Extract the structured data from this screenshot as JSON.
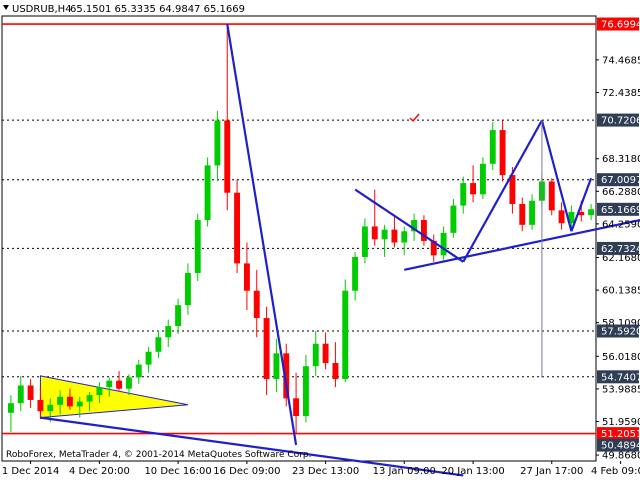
{
  "header": {
    "symbol": "USDRUB,H4",
    "ohlc": "65.1501 65.3335 64.9847 65.1669"
  },
  "footer": {
    "copyright": "RoboForex, MetaTrader 4, © 2001-2014 MetaQuotes Software Corp."
  },
  "colors": {
    "bull": "#00cc00",
    "bear": "#ff0000",
    "level_line": "#ff0000",
    "trend_blue": "#1f1fcc",
    "triangle_fill": "#ffff00",
    "price_badge": "#2f3d55",
    "red_badge": "#ff0000"
  },
  "chart_data": {
    "type": "candlestick",
    "title": "USDRUB,H4",
    "ylim": [
      49.5,
      77.2
    ],
    "x_tick_labels": [
      "1 Dec 2014",
      "4 Dec 20:00",
      "10 Dec 16:00",
      "16 Dec 09:00",
      "23 Dec 13:00",
      "13 Jan 09:00",
      "20 Jan 13:00",
      "27 Jan 17:00",
      "4 Feb 09:00"
    ],
    "y_tick_labels": [
      "74.4685",
      "72.4385",
      "68.3180",
      "66.2880",
      "64.2590",
      "62.1680",
      "60.1385",
      "58.1090",
      "56.0180",
      "53.9885",
      "51.9590",
      "49.8680"
    ],
    "price_labels": [
      {
        "label": "76.6994",
        "value": 76.6994,
        "style": "red"
      },
      {
        "label": "70.7206",
        "value": 70.7206,
        "style": "dark"
      },
      {
        "label": "67.0097",
        "value": 67.0097,
        "style": "dark"
      },
      {
        "label": "65.1669",
        "value": 65.1669,
        "style": "dark"
      },
      {
        "label": "62.7324",
        "value": 62.7324,
        "style": "dark"
      },
      {
        "label": "57.5920",
        "value": 57.592,
        "style": "dark"
      },
      {
        "label": "54.7407",
        "value": 54.7407,
        "style": "dark"
      },
      {
        "label": "51.2051",
        "value": 51.2051,
        "style": "red"
      },
      {
        "label": "50.4894",
        "value": 50.4894,
        "style": "dark"
      }
    ],
    "horizontal_levels": [
      {
        "value": 76.6994,
        "style": "solid-red"
      },
      {
        "value": 70.7206,
        "style": "dotted"
      },
      {
        "value": 67.0097,
        "style": "dotted"
      },
      {
        "value": 62.7324,
        "style": "dotted"
      },
      {
        "value": 57.592,
        "style": "dotted"
      },
      {
        "value": 54.7407,
        "style": "dotted"
      },
      {
        "value": 51.2051,
        "style": "solid-red"
      }
    ],
    "candles": [
      {
        "o": 52.5,
        "h": 53.6,
        "l": 51.3,
        "c": 53.1
      },
      {
        "o": 53.1,
        "h": 54.8,
        "l": 52.6,
        "c": 54.2
      },
      {
        "o": 54.2,
        "h": 54.6,
        "l": 52.8,
        "c": 53.3
      },
      {
        "o": 53.3,
        "h": 54.1,
        "l": 52.1,
        "c": 52.6
      },
      {
        "o": 52.6,
        "h": 53.4,
        "l": 51.9,
        "c": 53.0
      },
      {
        "o": 53.0,
        "h": 53.9,
        "l": 52.4,
        "c": 53.5
      },
      {
        "o": 53.5,
        "h": 54.0,
        "l": 52.7,
        "c": 52.9
      },
      {
        "o": 52.9,
        "h": 53.5,
        "l": 52.2,
        "c": 53.2
      },
      {
        "o": 53.2,
        "h": 53.8,
        "l": 52.6,
        "c": 53.6
      },
      {
        "o": 53.6,
        "h": 54.4,
        "l": 53.1,
        "c": 54.1
      },
      {
        "o": 54.1,
        "h": 54.7,
        "l": 53.5,
        "c": 54.5
      },
      {
        "o": 54.5,
        "h": 55.1,
        "l": 53.9,
        "c": 54.0
      },
      {
        "o": 54.0,
        "h": 54.9,
        "l": 53.6,
        "c": 54.7
      },
      {
        "o": 54.7,
        "h": 55.8,
        "l": 54.3,
        "c": 55.5
      },
      {
        "o": 55.5,
        "h": 56.6,
        "l": 55.0,
        "c": 56.3
      },
      {
        "o": 56.3,
        "h": 57.6,
        "l": 55.9,
        "c": 57.2
      },
      {
        "o": 57.2,
        "h": 58.3,
        "l": 56.6,
        "c": 57.9
      },
      {
        "o": 57.9,
        "h": 59.6,
        "l": 57.4,
        "c": 59.2
      },
      {
        "o": 59.2,
        "h": 61.8,
        "l": 58.6,
        "c": 61.2
      },
      {
        "o": 61.2,
        "h": 64.9,
        "l": 60.7,
        "c": 64.5
      },
      {
        "o": 64.5,
        "h": 68.4,
        "l": 64.1,
        "c": 67.9
      },
      {
        "o": 67.9,
        "h": 71.3,
        "l": 66.9,
        "c": 70.7
      },
      {
        "o": 70.7,
        "h": 76.7,
        "l": 65.1,
        "c": 66.2
      },
      {
        "o": 66.2,
        "h": 67.0,
        "l": 61.2,
        "c": 61.8
      },
      {
        "o": 61.8,
        "h": 63.1,
        "l": 58.9,
        "c": 60.1
      },
      {
        "o": 60.1,
        "h": 61.4,
        "l": 57.2,
        "c": 58.4
      },
      {
        "o": 58.4,
        "h": 59.1,
        "l": 53.6,
        "c": 54.6
      },
      {
        "o": 54.6,
        "h": 57.1,
        "l": 53.8,
        "c": 56.2
      },
      {
        "o": 56.2,
        "h": 56.8,
        "l": 52.9,
        "c": 53.4
      },
      {
        "o": 53.4,
        "h": 55.0,
        "l": 51.2,
        "c": 52.3
      },
      {
        "o": 52.3,
        "h": 56.1,
        "l": 51.9,
        "c": 55.4
      },
      {
        "o": 55.4,
        "h": 57.6,
        "l": 54.8,
        "c": 56.8
      },
      {
        "o": 56.8,
        "h": 57.5,
        "l": 55.2,
        "c": 55.6
      },
      {
        "o": 55.6,
        "h": 56.9,
        "l": 54.1,
        "c": 54.6
      },
      {
        "o": 54.6,
        "h": 60.8,
        "l": 54.4,
        "c": 60.1
      },
      {
        "o": 60.1,
        "h": 62.5,
        "l": 59.5,
        "c": 62.2
      },
      {
        "o": 62.2,
        "h": 64.6,
        "l": 61.8,
        "c": 64.1
      },
      {
        "o": 64.1,
        "h": 66.4,
        "l": 62.9,
        "c": 63.3
      },
      {
        "o": 63.3,
        "h": 64.2,
        "l": 62.2,
        "c": 63.9
      },
      {
        "o": 63.9,
        "h": 64.8,
        "l": 62.8,
        "c": 63.1
      },
      {
        "o": 63.1,
        "h": 64.1,
        "l": 62.3,
        "c": 63.8
      },
      {
        "o": 63.8,
        "h": 64.9,
        "l": 63.2,
        "c": 64.5
      },
      {
        "o": 64.5,
        "h": 64.8,
        "l": 62.9,
        "c": 63.2
      },
      {
        "o": 63.2,
        "h": 63.6,
        "l": 61.9,
        "c": 62.3
      },
      {
        "o": 62.3,
        "h": 64.1,
        "l": 62.0,
        "c": 63.7
      },
      {
        "o": 63.7,
        "h": 65.8,
        "l": 63.4,
        "c": 65.4
      },
      {
        "o": 65.4,
        "h": 67.2,
        "l": 64.9,
        "c": 66.8
      },
      {
        "o": 66.8,
        "h": 67.9,
        "l": 65.6,
        "c": 66.1
      },
      {
        "o": 66.1,
        "h": 68.4,
        "l": 65.8,
        "c": 68.0
      },
      {
        "o": 68.0,
        "h": 70.6,
        "l": 67.6,
        "c": 70.1
      },
      {
        "o": 70.1,
        "h": 70.7,
        "l": 66.9,
        "c": 67.3
      },
      {
        "o": 67.3,
        "h": 67.8,
        "l": 64.9,
        "c": 65.5
      },
      {
        "o": 65.5,
        "h": 65.9,
        "l": 63.8,
        "c": 64.2
      },
      {
        "o": 64.2,
        "h": 66.1,
        "l": 63.9,
        "c": 65.7
      },
      {
        "o": 65.7,
        "h": 67.4,
        "l": 65.2,
        "c": 66.9
      },
      {
        "o": 66.9,
        "h": 67.1,
        "l": 64.8,
        "c": 65.1
      },
      {
        "o": 65.1,
        "h": 65.6,
        "l": 63.9,
        "c": 64.3
      },
      {
        "o": 64.3,
        "h": 65.4,
        "l": 64.0,
        "c": 65.0
      },
      {
        "o": 65.0,
        "h": 65.7,
        "l": 64.4,
        "c": 64.8
      },
      {
        "o": 64.8,
        "h": 65.5,
        "l": 64.5,
        "c": 65.17
      }
    ],
    "drawn_lines": [
      {
        "name": "blue-drop",
        "style": "blue-thick",
        "points": [
          [
            22,
            76.7
          ],
          [
            29,
            50.5
          ]
        ]
      },
      {
        "name": "blue-base",
        "style": "blue-thick",
        "points": [
          [
            3,
            52.2
          ],
          [
            46,
            48.6
          ]
        ]
      },
      {
        "name": "blue-wave-a",
        "style": "blue-thick",
        "points": [
          [
            35,
            66.4
          ],
          [
            46,
            61.9
          ]
        ]
      },
      {
        "name": "blue-wave-b",
        "style": "blue-thick",
        "points": [
          [
            46,
            61.9
          ],
          [
            54,
            70.7
          ]
        ]
      },
      {
        "name": "blue-wave-c",
        "style": "blue-thick",
        "points": [
          [
            54,
            70.7
          ],
          [
            57,
            63.8
          ]
        ]
      },
      {
        "name": "blue-wave-d",
        "style": "blue-thick",
        "points": [
          [
            57,
            63.8
          ],
          [
            59,
            67.1
          ]
        ]
      },
      {
        "name": "blue-support",
        "style": "blue-thick",
        "points": [
          [
            40,
            61.4
          ],
          [
            64,
            64.5
          ]
        ]
      },
      {
        "name": "gray-drop",
        "style": "gray-thin",
        "points": [
          [
            54,
            70.7
          ],
          [
            54,
            54.7
          ]
        ]
      }
    ],
    "triangle": {
      "points": [
        [
          3,
          54.8
        ],
        [
          3,
          52.2
        ],
        [
          18,
          53.0
        ]
      ]
    }
  }
}
